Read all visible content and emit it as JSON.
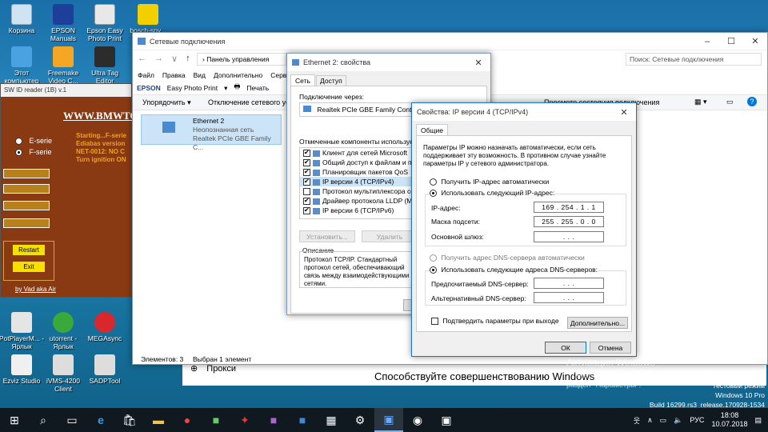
{
  "desktop": {
    "icons": [
      {
        "label": "Корзина"
      },
      {
        "label": "EPSON Manuals"
      },
      {
        "label": "Epson Easy Photo Print"
      },
      {
        "label": "bosch-spv..."
      },
      {
        "label": "Этот компьютер"
      },
      {
        "label": "Freemake Video C..."
      },
      {
        "label": "Ultra Tag Editor"
      },
      {
        "label": "PotPlayerM... - Ярлык"
      },
      {
        "label": "utorrent - Ярлык"
      },
      {
        "label": "MEGAsync"
      },
      {
        "label": "Ezviz Studio"
      },
      {
        "label": "iVMS-4200 Client"
      },
      {
        "label": "SADPTool"
      }
    ],
    "watermark_line1": "Активация Windows",
    "watermark_line2": "Чтобы активировать Windows, перейдите в",
    "watermark_line3": "раздел \"Параметры\".",
    "build_line1": "Тестовый режим",
    "build_line2": "Windows 10 Pro",
    "build_line3": "Build 16299.rs3_release.170928-1534",
    "improve_text": "Способствуйте совершенствованию Windows",
    "proxy_text": "Прокси"
  },
  "bmw_app": {
    "title": "SW ID reader (1B)  v.1",
    "header": "WWW.BMWTO",
    "radio1": "E-serie",
    "radio2": "F-serie",
    "log": "Starting...F-serie\nEdiabas version\nNET-0012: NO C\nTurn ignition ON",
    "restart": "Restart",
    "exit": "Exit",
    "author": "by Vad aka Air"
  },
  "net_connections": {
    "title": "Сетевые подключения",
    "address_path": "Панель управления",
    "search_placeholder": "Поиск: Сетевые подключения",
    "menu": [
      "Файл",
      "Правка",
      "Вид",
      "Дополнительно",
      "Серв"
    ],
    "epson_label": "EPSON",
    "epson_app": "Easy Photo Print",
    "epson_print": "Печать",
    "toolbar_organize": "Упорядочить",
    "toolbar_disconnect": "Отключение сетевого уст",
    "toolbar_view_status": "Просмотр состояния подключения",
    "adapter_name": "Ethernet 2",
    "adapter_status": "Неопознанная сеть",
    "adapter_device": "Realtek PCIe GBE Family C...",
    "status_items": "Элементов: 3",
    "status_selected": "Выбран 1 элемент"
  },
  "eth_props": {
    "title": "Ethernet 2: свойства",
    "tab_network": "Сеть",
    "tab_access": "Доступ",
    "connect_via_label": "Подключение через:",
    "adapter": "Realtek PCIe GBE Family Controller",
    "components_label": "Отмеченные компоненты используются",
    "components": [
      {
        "label": "Клиент для сетей Microsoft",
        "checked": true
      },
      {
        "label": "Общий доступ к файлам и прин",
        "checked": true
      },
      {
        "label": "Планировщик пакетов QoS",
        "checked": true
      },
      {
        "label": "IP версии 4 (TCP/IPv4)",
        "checked": true
      },
      {
        "label": "Протокол мультиплексора сете",
        "checked": false
      },
      {
        "label": "Драйвер протокола LLDP (Майк",
        "checked": true
      },
      {
        "label": "IP версии 6 (TCP/IPv6)",
        "checked": true
      }
    ],
    "install_button": "Установить...",
    "remove_button": "Удалить",
    "description_label": "Описание",
    "description_text": "Протокол TCP/IP. Стандартный протокол сетей, обеспечивающий связь между взаимодействующими сетями."
  },
  "ipv4": {
    "title": "Свойства: IP версии 4 (TCP/IPv4)",
    "tab_general": "Общие",
    "intro": "Параметры IP можно назначать автоматически, если сеть поддерживает эту возможность. В противном случае узнайте параметры IP у сетевого администратора.",
    "auto_ip": "Получить IP-адрес автоматически",
    "manual_ip": "Использовать следующий IP-адрес:",
    "ip_label": "IP-адрес:",
    "ip_value": "169 . 254 .  1  .  1",
    "mask_label": "Маска подсети:",
    "mask_value": "255 . 255 .  0  .  0",
    "gateway_label": "Основной шлюз:",
    "gateway_value": ".      .      .",
    "auto_dns": "Получить адрес DNS-сервера автоматически",
    "manual_dns": "Использовать следующие адреса DNS-серверов:",
    "pref_dns_label": "Предпочитаемый DNS-сервер:",
    "pref_dns_value": ".      .      .",
    "alt_dns_label": "Альтернативный DNS-сервер:",
    "alt_dns_value": ".      .      .",
    "validate_label": "Подтвердить параметры при выходе",
    "advanced_button": "Дополнительно...",
    "ok_button": "ОК",
    "cancel_button": "Отмена"
  },
  "tray": {
    "lang": "РУС",
    "time": "18:08",
    "date": "10.07.2018"
  },
  "colors": {
    "accent": "#0078d7",
    "bmw_bg": "#8a3a12"
  }
}
